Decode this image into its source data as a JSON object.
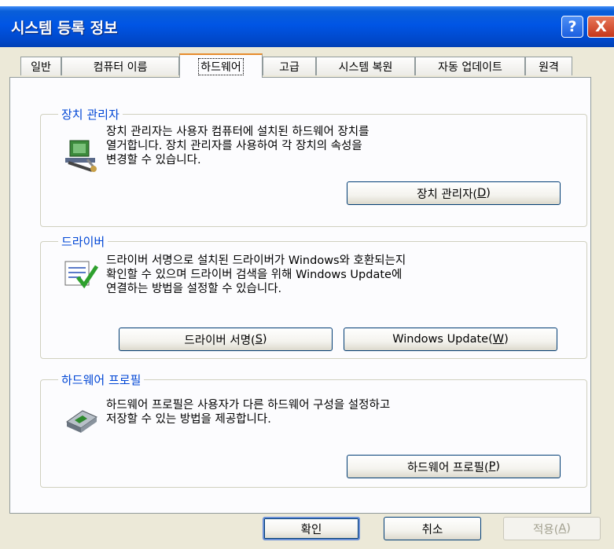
{
  "window": {
    "title": "시스템 등록 정보",
    "help_label": "?",
    "close_label": "X"
  },
  "tabs": [
    {
      "label": "일반"
    },
    {
      "label": "컴퓨터 이름"
    },
    {
      "label": "하드웨어"
    },
    {
      "label": "고급"
    },
    {
      "label": "시스템 복원"
    },
    {
      "label": "자동 업데이트"
    },
    {
      "label": "원격"
    }
  ],
  "device_manager": {
    "title": "장치 관리자",
    "line1": "장치 관리자는 사용자 컴퓨터에 설치된 하드웨어 장치를",
    "line2": "열거합니다. 장치 관리자를 사용하여 각 장치의 속성을",
    "line3": "변경할 수 있습니다.",
    "button_text": "장치 관리자(",
    "button_key": "D",
    "button_end": ")"
  },
  "drivers": {
    "title": "드라이버",
    "line1": "드라이버 서명으로 설치된 드라이버가 Windows와 호환되는지",
    "line2": "확인할 수 있으며 드라이버 검색을 위해 Windows Update에",
    "line3": "연결하는 방법을 설정할 수 있습니다.",
    "signing_text": "드라이버 서명(",
    "signing_key": "S",
    "signing_end": ")",
    "update_text": "Windows Update(",
    "update_key": "W",
    "update_end": ")"
  },
  "hw_profiles": {
    "title": "하드웨어 프로필",
    "line1": "하드웨어 프로필은 사용자가 다른 하드웨어 구성을 설정하고",
    "line2": "저장할 수 있는 방법을 제공합니다.",
    "button_text": "하드웨어 프로필(",
    "button_key": "P",
    "button_end": ")"
  },
  "footer": {
    "ok": "확인",
    "cancel": "취소",
    "apply_text": "적용(",
    "apply_key": "A",
    "apply_end": ")"
  }
}
